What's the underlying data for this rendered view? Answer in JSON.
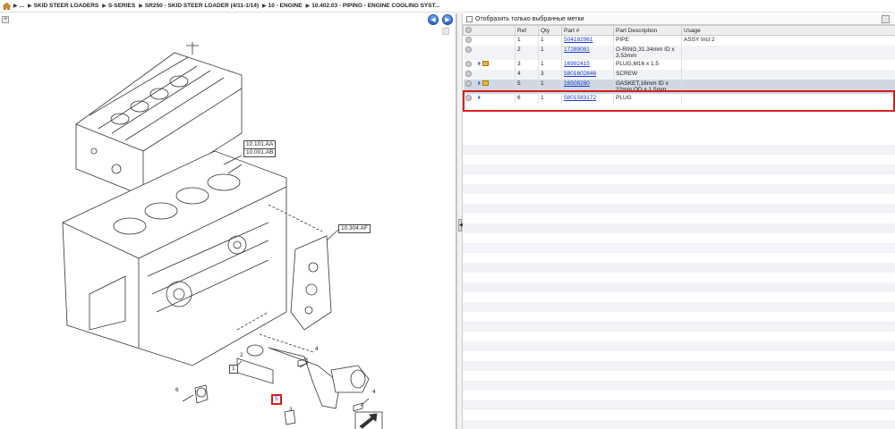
{
  "breadcrumb": {
    "items": [
      "...",
      "SKID STEER LOADERS",
      "S-SERIES",
      "SR250 - SKID STEER LOADER (4/11-1/14)",
      "10 - ENGINE",
      "10.402.03 - PIPING - ENGINE COOLING SYST..."
    ]
  },
  "drawing": {
    "callouts": {
      "cyl_head_1": "10.101.AA",
      "cyl_head_2": "10.001.AB",
      "cover": "10.304.AF"
    },
    "refs": {
      "r1": "1",
      "r2": "2",
      "r3": "3",
      "r4a": "4",
      "r4b": "4",
      "r5": "5",
      "r6": "6"
    }
  },
  "filter": {
    "label": "Отобразить только выбранные метки"
  },
  "table": {
    "headers": {
      "ref": "Ref",
      "qty": "Qty",
      "part": "Part #",
      "desc": "Part Description",
      "usage": "Usage"
    },
    "rows": [
      {
        "ref": "1",
        "qty": "1",
        "part": "504182961",
        "desc": "PIPE",
        "usage": "ASSY Incl 2"
      },
      {
        "ref": "2",
        "qty": "1",
        "part": "17289081",
        "desc": "O-RING,31.34mm ID x 3.53mm",
        "usage": ""
      },
      {
        "ref": "3",
        "qty": "1",
        "part": "16992415",
        "desc": "PLUG,M16 x 1.5",
        "usage": ""
      },
      {
        "ref": "4",
        "qty": "3",
        "part": "5801602846",
        "desc": "SCREW",
        "usage": ""
      },
      {
        "ref": "5",
        "qty": "1",
        "part": "16508260",
        "desc": "GASKET,16mm ID x 22mm OD x 1.5mm",
        "usage": ""
      },
      {
        "ref": "6",
        "qty": "1",
        "part": "5801583172",
        "desc": "PLUG",
        "usage": ""
      }
    ]
  },
  "colors": {
    "selection": "#d81c1c",
    "link": "#1a3bd1",
    "selected_row": "#cfd8e3"
  }
}
